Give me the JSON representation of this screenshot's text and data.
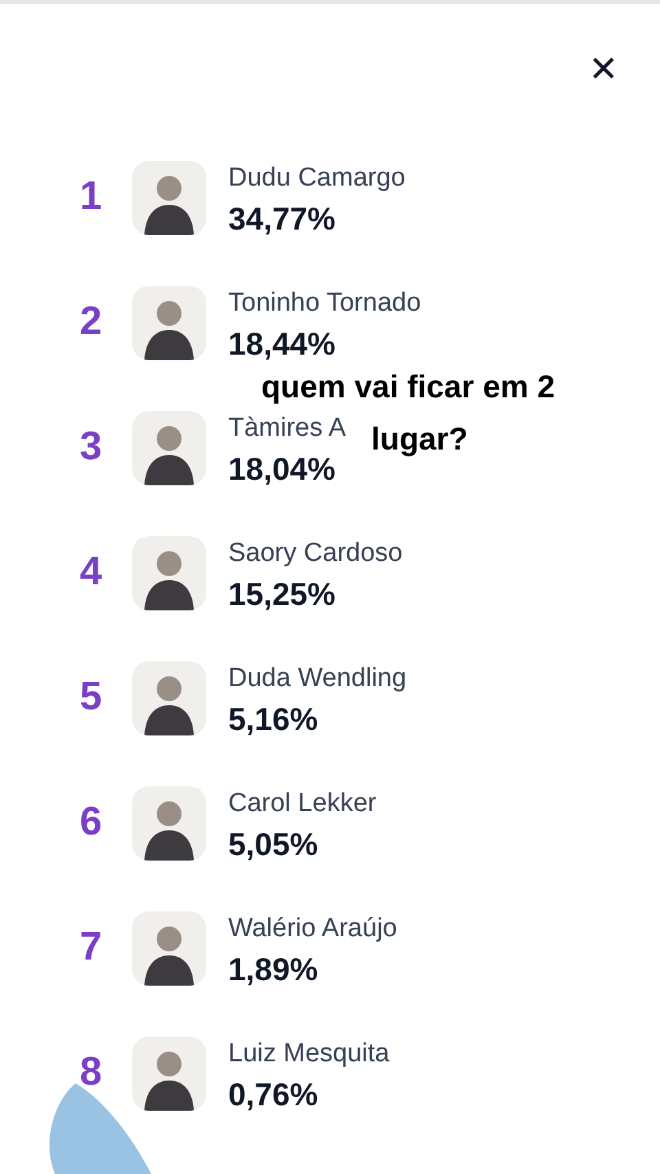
{
  "close_button": {
    "label": "✕"
  },
  "ranking": [
    {
      "rank": "1",
      "name": "Dudu Camargo",
      "percent": "34,77%"
    },
    {
      "rank": "2",
      "name": "Toninho Tornado",
      "percent": "18,44%"
    },
    {
      "rank": "3",
      "name": "Tàmires A",
      "percent": "18,04%"
    },
    {
      "rank": "4",
      "name": "Saory Cardoso",
      "percent": "15,25%"
    },
    {
      "rank": "5",
      "name": "Duda Wendling",
      "percent": "5,16%"
    },
    {
      "rank": "6",
      "name": "Carol Lekker",
      "percent": "5,05%"
    },
    {
      "rank": "7",
      "name": "Walério Araújo",
      "percent": "1,89%"
    },
    {
      "rank": "8",
      "name": "Luiz Mesquita",
      "percent": "0,76%"
    }
  ],
  "overlay_caption": {
    "lines": [
      "quem vai ficar em 2",
      "lugar?"
    ]
  }
}
